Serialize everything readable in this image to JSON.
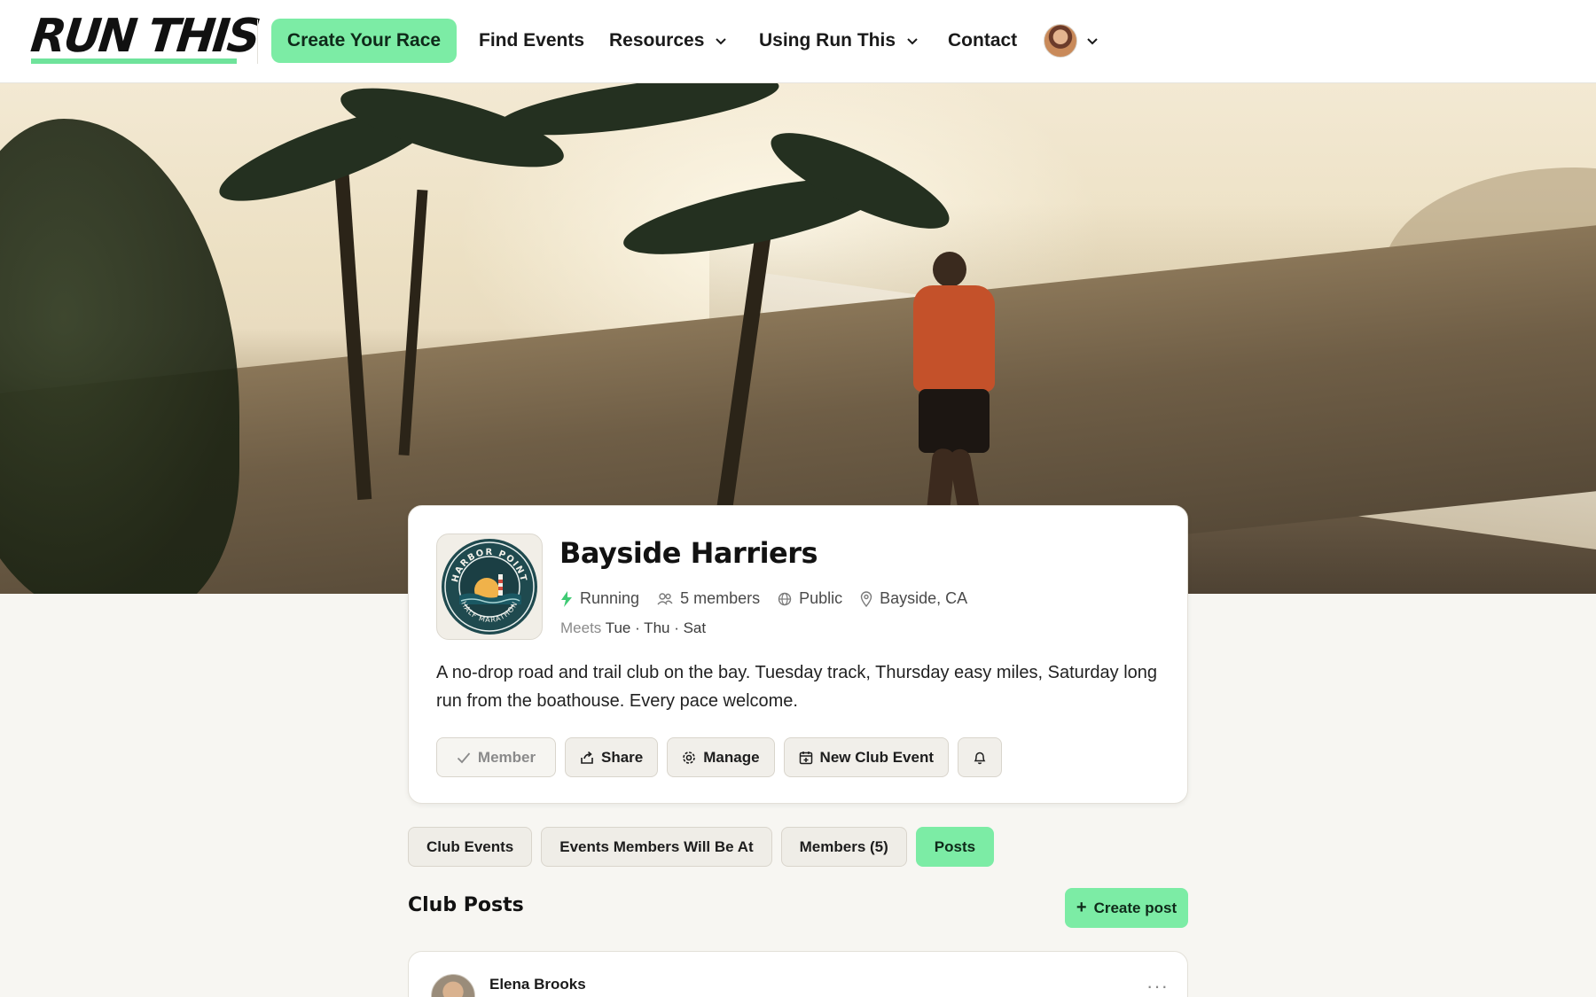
{
  "nav": {
    "logo_text": "RUN THIS",
    "create_race": "Create Your Race",
    "find_events": "Find Events",
    "resources": "Resources",
    "using": "Using Run This",
    "contact": "Contact",
    "avatar_icon": "user-avatar"
  },
  "club": {
    "badge_text_top": "HARBOR POINT",
    "badge_text_bottom": "HALF MARATHON",
    "name": "Bayside Harriers",
    "sport": "Running",
    "members": "5 members",
    "visibility": "Public",
    "location": "Bayside, CA",
    "meets_label": "Meets",
    "meets_days": "Tue · Thu · Sat",
    "description": "A no-drop road and trail club on the bay. Tuesday track, Thursday easy miles, Saturday long run from the boathouse. Every pace welcome.",
    "actions": {
      "member": "Member",
      "share": "Share",
      "manage": "Manage",
      "new_event": "New Club Event"
    }
  },
  "tabs": {
    "club_events": "Club Events",
    "events_members": "Events Members Will Be At",
    "members": "Members (5)",
    "posts": "Posts",
    "active": "Posts"
  },
  "posts": {
    "title": "Club Posts",
    "create_label": "Create post",
    "first_author": "Elena Brooks",
    "more": "···"
  },
  "colors": {
    "accent": "#7ceca5",
    "background": "#f7f6f2",
    "badge_dark": "#1f4a4f",
    "badge_sun": "#f0b24a"
  }
}
